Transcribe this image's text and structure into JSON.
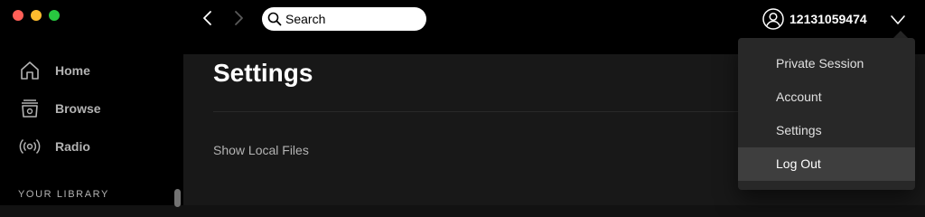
{
  "window": {
    "traffic_lights": {
      "close": "#ff5f57",
      "minimize": "#febc2e",
      "maximize": "#28c840"
    }
  },
  "sidebar": {
    "items": [
      {
        "label": "Home",
        "icon": "home-icon"
      },
      {
        "label": "Browse",
        "icon": "browse-icon"
      },
      {
        "label": "Radio",
        "icon": "radio-icon"
      }
    ],
    "library_label": "YOUR LIBRARY"
  },
  "topbar": {
    "search": {
      "placeholder": "Search",
      "value": ""
    },
    "username": "12131059474"
  },
  "main": {
    "title": "Settings",
    "settings": [
      {
        "label": "Show Local Files"
      }
    ]
  },
  "user_menu": {
    "items": [
      {
        "label": "Private Session"
      },
      {
        "label": "Account"
      },
      {
        "label": "Settings"
      },
      {
        "label": "Log Out",
        "highlighted": true
      }
    ]
  },
  "colors": {
    "background": "#121212",
    "sidebar": "#000000",
    "menu": "#282828",
    "menu_hover": "#3e3e3e"
  }
}
